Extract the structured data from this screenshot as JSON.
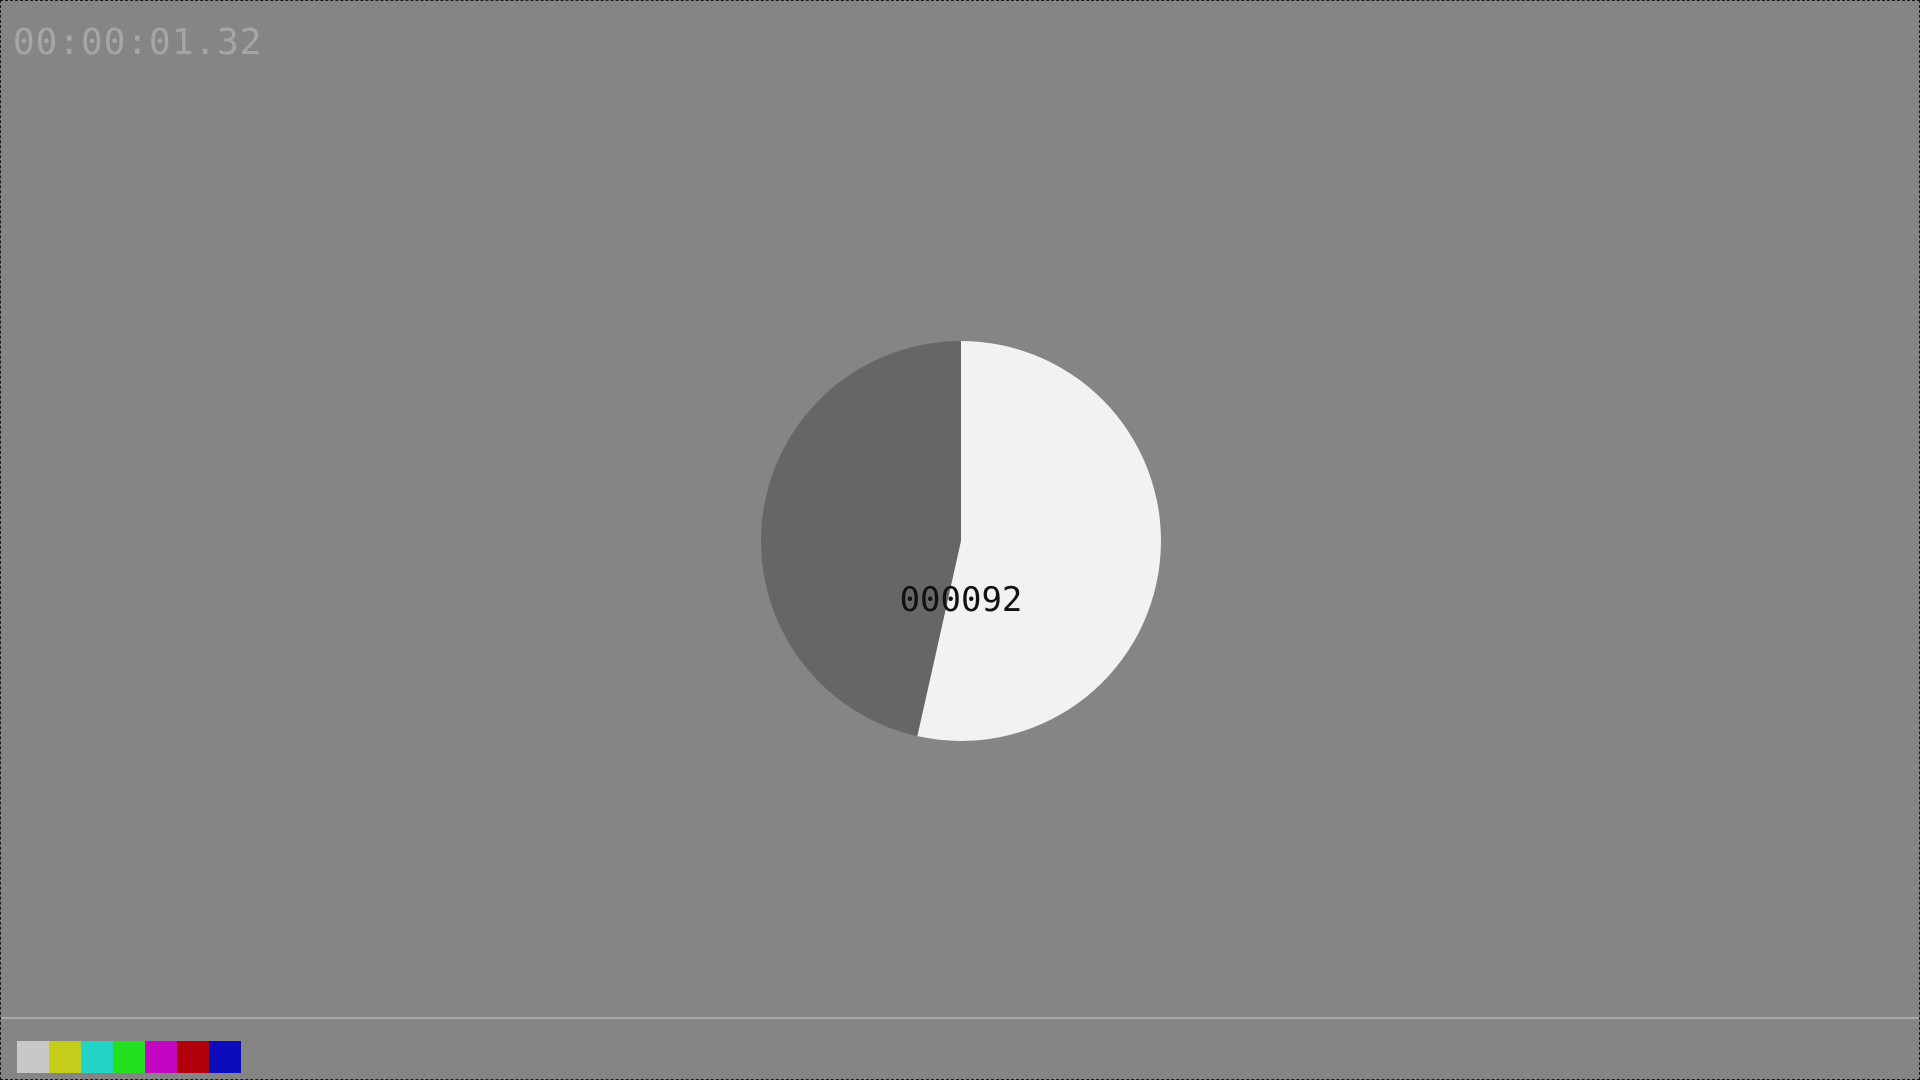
{
  "timecode": "00:00:01.32",
  "frame_counter": "000092",
  "dial": {
    "progress_fraction": 0.535,
    "filled_color": "#f2f2f2",
    "remaining_color": "#666666"
  },
  "background_color": "#858585",
  "color_bars": [
    {
      "name": "gray",
      "color": "#c8c8c8"
    },
    {
      "name": "yellow",
      "color": "#c6cc1a"
    },
    {
      "name": "cyan",
      "color": "#22d4c6"
    },
    {
      "name": "green",
      "color": "#22e01e"
    },
    {
      "name": "magenta",
      "color": "#c405c4"
    },
    {
      "name": "red",
      "color": "#b2000c"
    },
    {
      "name": "blue",
      "color": "#0c0cbc"
    }
  ]
}
